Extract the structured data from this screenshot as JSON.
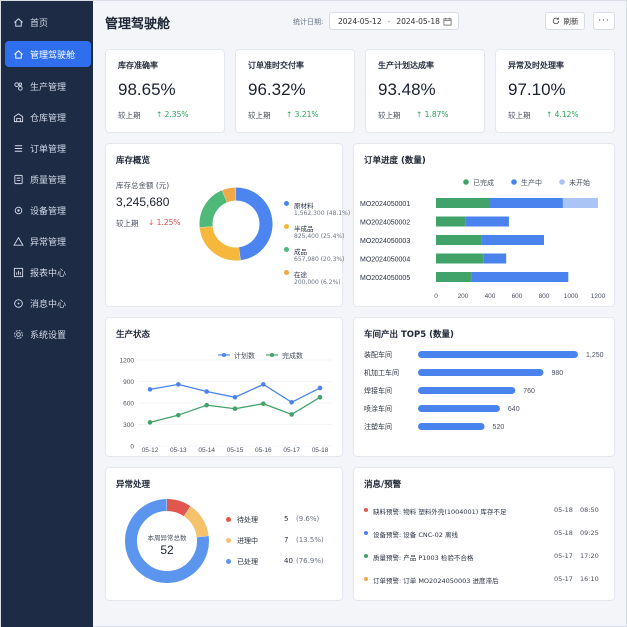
{
  "sidebar": {
    "items": [
      {
        "label": "首页",
        "icon": "home-icon",
        "active": false
      },
      {
        "label": "管理驾驶舱",
        "icon": "dashboard-icon",
        "active": true
      },
      {
        "label": "生产管理",
        "icon": "production-icon",
        "active": false
      },
      {
        "label": "仓库管理",
        "icon": "warehouse-icon",
        "active": false
      },
      {
        "label": "订单管理",
        "icon": "order-icon",
        "active": false
      },
      {
        "label": "质量管理",
        "icon": "quality-icon",
        "active": false
      },
      {
        "label": "设备管理",
        "icon": "equipment-icon",
        "active": false
      },
      {
        "label": "异常管理",
        "icon": "alert-icon",
        "active": false
      },
      {
        "label": "报表中心",
        "icon": "report-icon",
        "active": false
      },
      {
        "label": "消息中心",
        "icon": "message-icon",
        "active": false
      },
      {
        "label": "系统设置",
        "icon": "settings-icon",
        "active": false
      }
    ]
  },
  "header": {
    "title": "管理驾驶舱",
    "date_label": "统计日期:",
    "date_start": "2024-05-12",
    "date_sep": "-",
    "date_end": "2024-05-18",
    "refresh_label": "刷新",
    "more_label": "···"
  },
  "kpis": [
    {
      "title": "库存准确率",
      "value": "98.65%",
      "cmp": "较上期",
      "delta": "↑ 2.35%"
    },
    {
      "title": "订单准时交付率",
      "value": "96.32%",
      "cmp": "较上期",
      "delta": "↑ 3.21%"
    },
    {
      "title": "生产计划达成率",
      "value": "93.48%",
      "cmp": "较上期",
      "delta": "↑ 1.87%"
    },
    {
      "title": "异常及时处理率",
      "value": "97.10%",
      "cmp": "较上期",
      "delta": "↑ 4.12%"
    }
  ],
  "inventory": {
    "title": "库存概览",
    "total_label": "库存总金额 (元)",
    "total_value": "3,245,680",
    "cmp": "较上期",
    "delta": "↓ 1.25%",
    "legend": [
      {
        "name": "原材料",
        "value": "1,562,300",
        "pct": "(48.1%)",
        "color": "#4c84f0",
        "share": 48.1
      },
      {
        "name": "半成品",
        "value": "825,400",
        "pct": "(25.4%)",
        "color": "#f5b83d",
        "share": 25.4
      },
      {
        "name": "成品",
        "value": "657,980",
        "pct": "(20.3%)",
        "color": "#4fb97a",
        "share": 20.3
      },
      {
        "name": "在途",
        "value": "200,000",
        "pct": "(6.2%)",
        "color": "#f0a848",
        "share": 6.2
      }
    ]
  },
  "order_progress": {
    "title": "订单进度 (数量)",
    "legend": [
      {
        "name": "已完成",
        "color": "#41a36a"
      },
      {
        "name": "生产中",
        "color": "#4a82ee"
      },
      {
        "name": "未开始",
        "color": "#a9c4f5"
      }
    ],
    "ticks": [
      "0",
      "200",
      "400",
      "600",
      "800",
      "1000",
      "1200"
    ]
  },
  "production": {
    "title": "生产状态",
    "y_ticks": [
      "1200",
      "900",
      "600",
      "300",
      "0"
    ],
    "legend": [
      {
        "name": "计划数",
        "color": "#4a82ee"
      },
      {
        "name": "完成数",
        "color": "#41a36a"
      }
    ]
  },
  "workshop": {
    "title": "车间产出 TOP5 (数量)"
  },
  "exceptions": {
    "title": "异常处理",
    "center_label": "本周异常总数",
    "center_value": "52",
    "legend": [
      {
        "name": "待处理",
        "count": "5",
        "pct": "(9.6%)",
        "color": "#e0574f",
        "share": 9.6
      },
      {
        "name": "进理中",
        "count": "7",
        "pct": "(13.5%)",
        "color": "#f3c26a",
        "share": 13.5
      },
      {
        "name": "已处理",
        "count": "40",
        "pct": "(76.9%)",
        "color": "#5b95ee",
        "share": 76.9
      }
    ]
  },
  "messages": {
    "title": "消息/预警",
    "items": [
      {
        "text": "缺料预警: 物料 塑料外壳(1004001) 库存不足",
        "date": "05-18",
        "time": "08:50",
        "color": "#e0574f"
      },
      {
        "text": "设备预警: 设备 CNC-02 离线",
        "date": "05-18",
        "time": "09:25",
        "color": "#4a82ee"
      },
      {
        "text": "质量预警: 产品 P1003 检验不合格",
        "date": "05-17",
        "time": "17:20",
        "color": "#41a36a"
      },
      {
        "text": "订单预警: 订单 MO2024050003 进度滞后",
        "date": "05-17",
        "time": "16:10",
        "color": "#f0a848"
      }
    ]
  },
  "chart_data": [
    {
      "type": "bar",
      "orientation": "horizontal",
      "stacked": true,
      "title": "订单进度 (数量)",
      "categories": [
        "MO2024050001",
        "MO2024050002",
        "MO2024050003",
        "MO2024050004",
        "MO2024050005"
      ],
      "series": [
        {
          "name": "已完成",
          "values": [
            400,
            220,
            340,
            350,
            260
          ]
        },
        {
          "name": "生产中",
          "values": [
            540,
            320,
            460,
            170,
            720
          ]
        },
        {
          "name": "未开始",
          "values": [
            260,
            0,
            0,
            0,
            0
          ]
        }
      ],
      "xlim": [
        0,
        1200
      ]
    },
    {
      "type": "line",
      "title": "生产状态",
      "categories": [
        "05-12",
        "05-13",
        "05-14",
        "05-15",
        "05-16",
        "05-17",
        "05-18"
      ],
      "series": [
        {
          "name": "计划数",
          "values": [
            790,
            860,
            760,
            680,
            860,
            610,
            810
          ]
        },
        {
          "name": "完成数",
          "values": [
            330,
            430,
            570,
            520,
            590,
            440,
            680
          ]
        }
      ],
      "ylim": [
        0,
        1200
      ]
    },
    {
      "type": "bar",
      "orientation": "horizontal",
      "title": "车间产出 TOP5 (数量)",
      "categories": [
        "装配车间",
        "机加工车间",
        "焊接车间",
        "喷涂车间",
        "注塑车间"
      ],
      "values": [
        1250,
        980,
        760,
        640,
        520
      ],
      "labels": [
        "1,250",
        "980",
        "760",
        "640",
        "520"
      ]
    }
  ]
}
